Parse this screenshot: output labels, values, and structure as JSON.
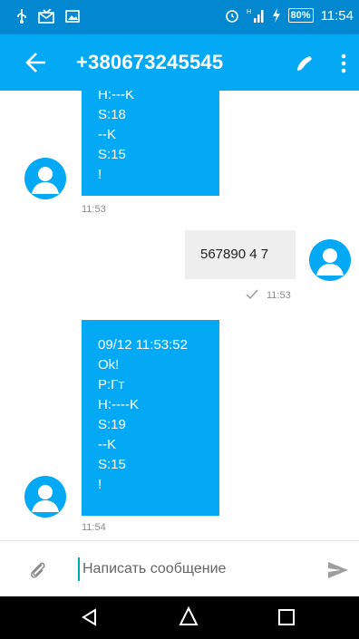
{
  "status_bar": {
    "battery": "80%",
    "time": "11:54",
    "icons": [
      "usb-icon",
      "mail-icon",
      "image-icon",
      "alarm-icon",
      "signal-icon",
      "charging-icon"
    ]
  },
  "header": {
    "title": "+380673245545",
    "icons": [
      "back-arrow-icon",
      "phone-icon",
      "more-vert-icon"
    ]
  },
  "messages": [
    {
      "direction": "incoming",
      "lines": [
        "H:---K",
        "S:18",
        "--K",
        "S:15",
        "!"
      ],
      "time": "11:53"
    },
    {
      "direction": "outgoing",
      "lines": [
        "567890 4 7"
      ],
      "time": "11:53",
      "status_icon": "check-icon"
    },
    {
      "direction": "incoming",
      "lines": [
        "09/12 11:53:52",
        "Ok!",
        "P:Гт",
        "H:----K",
        "S:19",
        "--K",
        "S:15",
        "!"
      ],
      "time": "11:54"
    }
  ],
  "composer": {
    "placeholder": "Написать сообщение",
    "value": ""
  },
  "colors": {
    "status_bar": "#0288d1",
    "app_bar": "#03a9f4",
    "incoming_bubble": "#03a9f4",
    "outgoing_bubble": "#eeeeee"
  },
  "nav_bar": {
    "icons": [
      "nav-back-icon",
      "nav-home-icon",
      "nav-recents-icon"
    ]
  }
}
